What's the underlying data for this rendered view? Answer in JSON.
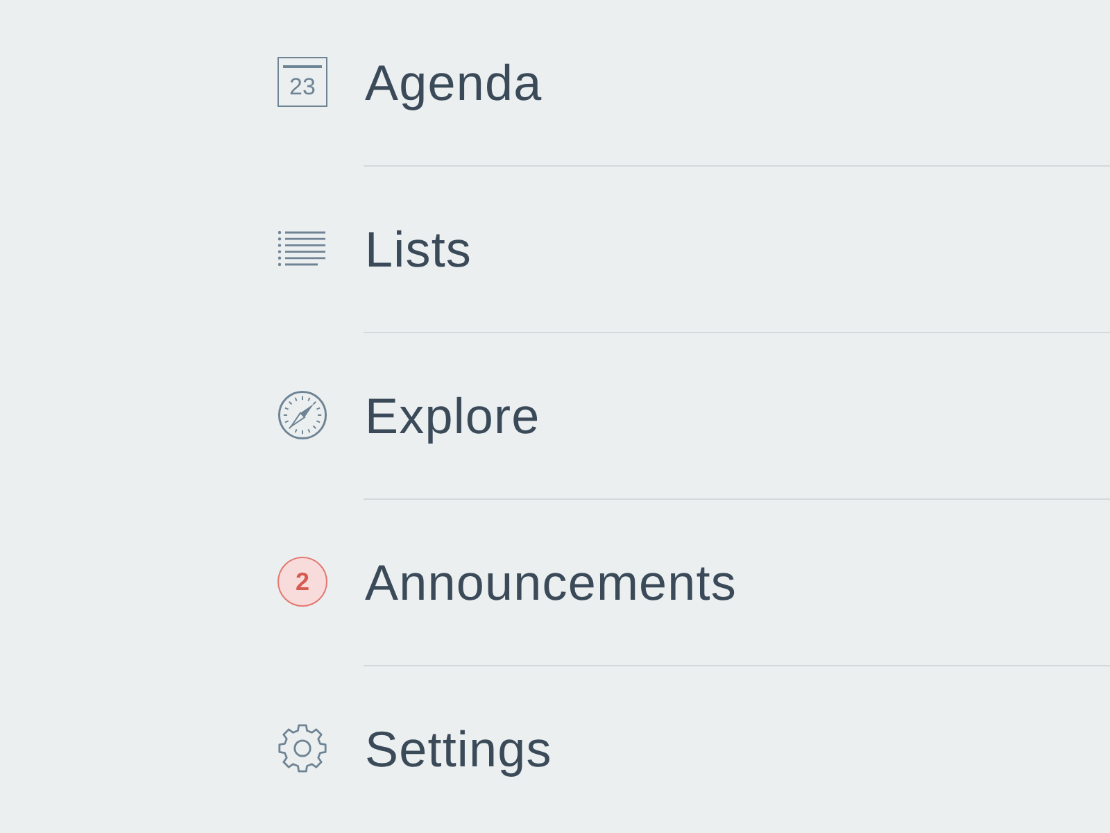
{
  "menu": {
    "items": [
      {
        "kind": "calendar",
        "label": "Agenda",
        "date": "23"
      },
      {
        "kind": "list",
        "label": "Lists"
      },
      {
        "kind": "compass",
        "label": "Explore"
      },
      {
        "kind": "badge",
        "label": "Announcements",
        "count": "2"
      },
      {
        "kind": "gear",
        "label": "Settings"
      }
    ]
  }
}
